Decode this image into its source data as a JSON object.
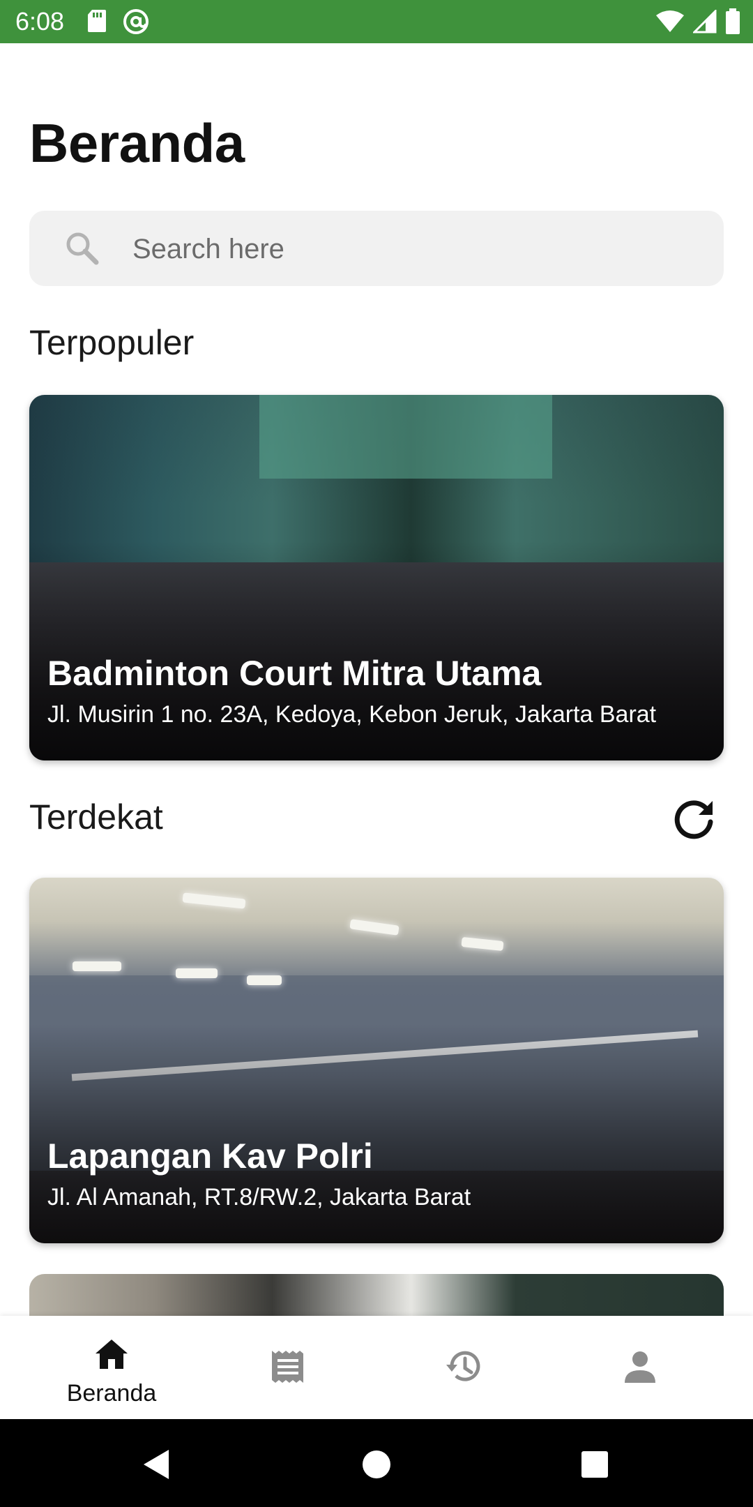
{
  "status_bar": {
    "time": "6:08",
    "left_icons": [
      "sd-card-icon",
      "at-sign-icon"
    ],
    "right_icons": [
      "wifi-icon",
      "signal-icon",
      "battery-icon"
    ],
    "color": "#3f923c"
  },
  "header": {
    "title": "Beranda"
  },
  "search": {
    "placeholder": "Search here",
    "value": ""
  },
  "sections": {
    "popular": {
      "title": "Terpopuler"
    },
    "nearby": {
      "title": "Terdekat",
      "action_icon": "refresh-icon"
    }
  },
  "cards": [
    {
      "title": "Badminton Court Mitra Utama",
      "address": "Jl. Musirin 1 no. 23A, Kedoya, Kebon Jeruk, Jakarta Barat"
    },
    {
      "title": "Lapangan Kav Polri",
      "address": "Jl. Al Amanah, RT.8/RW.2, Jakarta Barat"
    }
  ],
  "bottom_nav": {
    "items": [
      {
        "icon": "home-icon",
        "label": "Beranda",
        "active": true
      },
      {
        "icon": "receipt-icon",
        "label": "",
        "active": false
      },
      {
        "icon": "history-icon",
        "label": "",
        "active": false
      },
      {
        "icon": "person-icon",
        "label": "",
        "active": false
      }
    ]
  },
  "system_nav": [
    "back-icon",
    "home-circle-icon",
    "recents-icon"
  ]
}
